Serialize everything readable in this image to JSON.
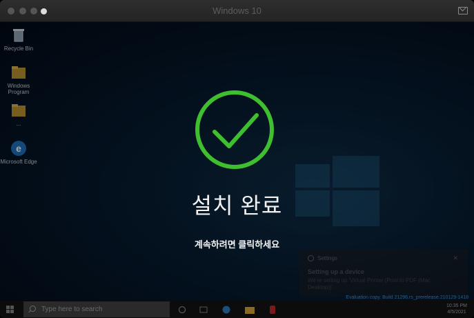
{
  "window": {
    "title": "Windows 10"
  },
  "desktop": {
    "icons": [
      {
        "label": "Recycle Bin",
        "icon": "recycle-bin-icon"
      },
      {
        "label": "Windows Program",
        "icon": "folder-icon"
      },
      {
        "label": "...",
        "icon": "folder-icon"
      },
      {
        "label": "Microsoft Edge",
        "icon": "edge-icon"
      }
    ]
  },
  "completion": {
    "title": "설치 완료",
    "subtitle": "계속하려면 클릭하세요",
    "accent": "#3fbf2f"
  },
  "toast": {
    "app": "Settings",
    "title": "Setting up a device",
    "body": "We're setting up 'Virtual Printer (Print to PDF (Mac Desktop))'."
  },
  "watermark": {
    "line1": "Evaluation copy. Build 21296.rs_prerelease.210129-1418"
  },
  "taskbar": {
    "search_placeholder": "Type here to search",
    "time": "10:35 PM",
    "date": "4/5/2021"
  }
}
